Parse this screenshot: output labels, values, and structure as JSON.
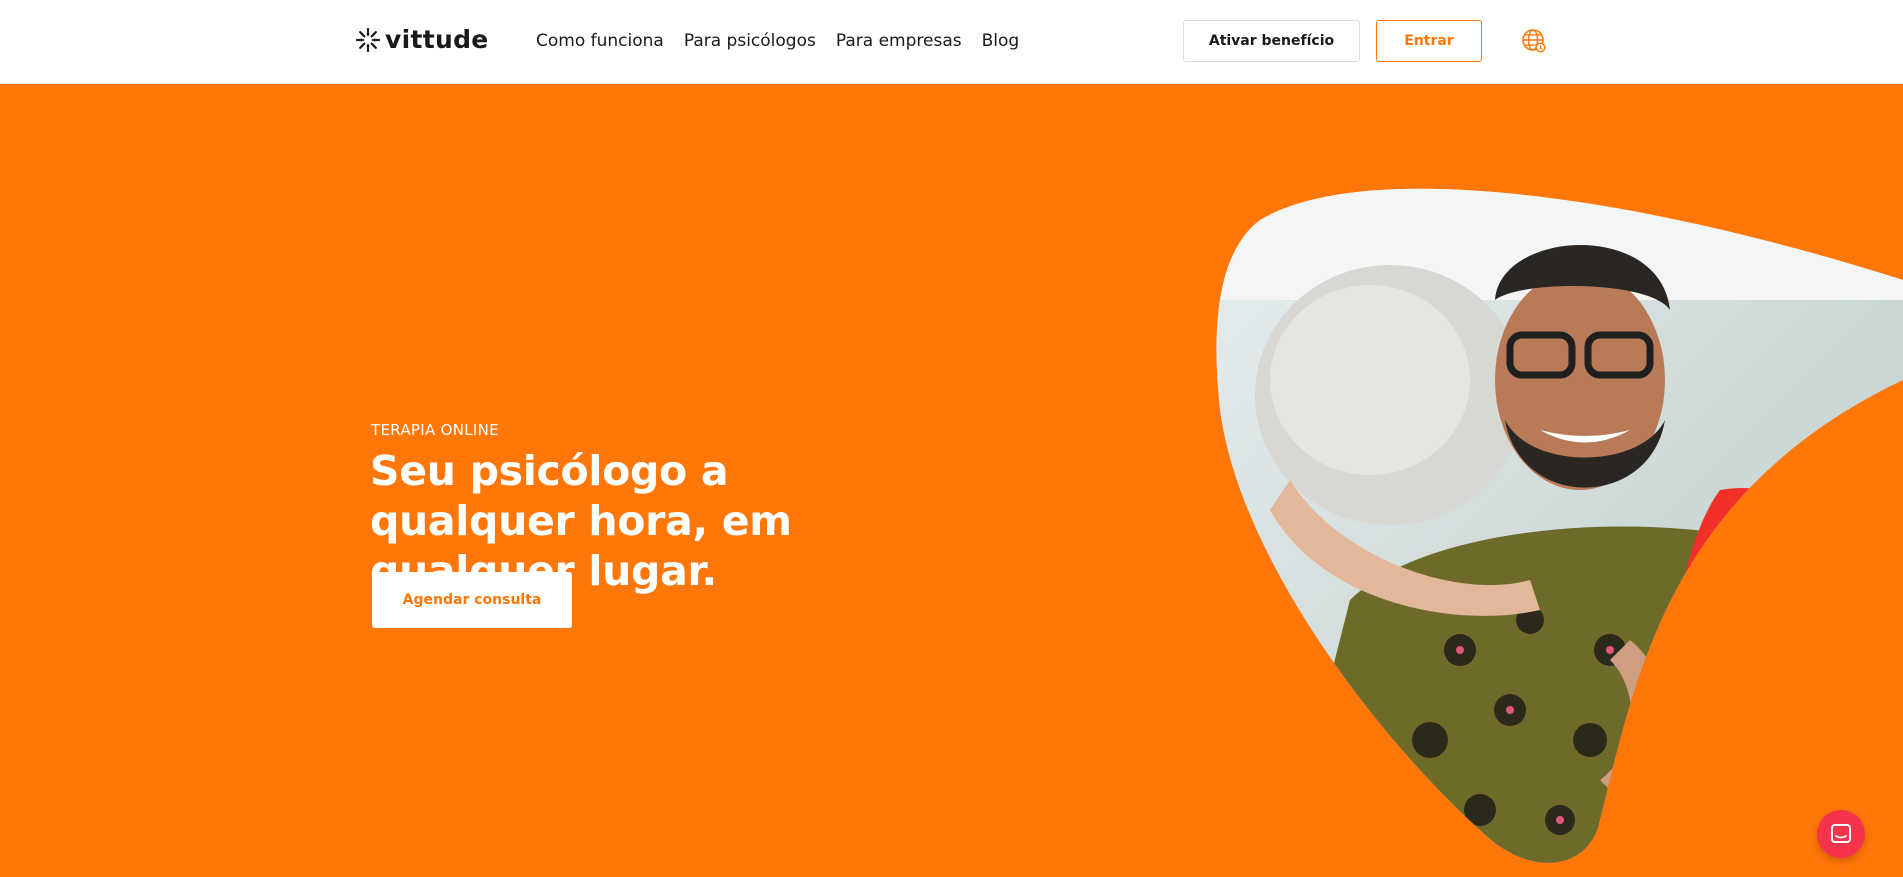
{
  "header": {
    "logo_text": "vittude",
    "nav": [
      {
        "label": "Como funciona"
      },
      {
        "label": "Para psicólogos"
      },
      {
        "label": "Para empresas"
      },
      {
        "label": "Blog"
      }
    ],
    "activate_benefit_label": "Ativar benefício",
    "login_label": "Entrar",
    "language_icon": "globe-icon"
  },
  "hero": {
    "eyebrow": "TERAPIA ONLINE",
    "headline": "Seu psicólogo a qualquer hora, em qualquer lugar.",
    "cta_label": "Agendar consulta",
    "image": "photo-two-people-hugging"
  },
  "chat": {
    "icon": "chat-icon"
  },
  "colors": {
    "brand_orange": "#ff7609",
    "accent_red": "#f5334a",
    "header_bg": "#ffffff",
    "text_dark": "#1a1a1a"
  }
}
